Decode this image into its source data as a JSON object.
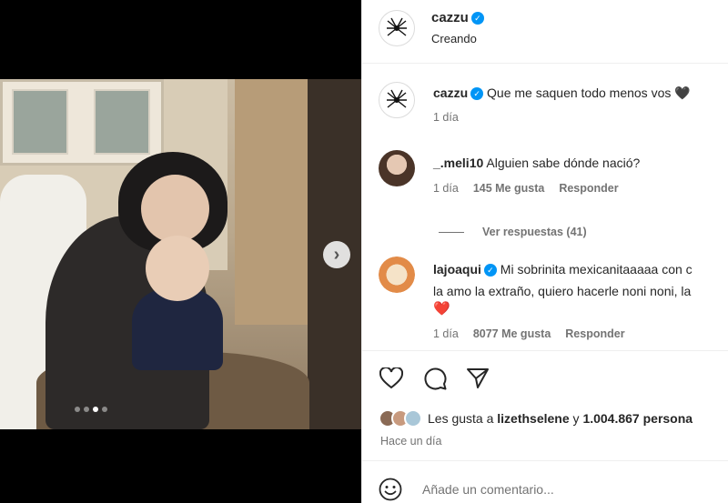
{
  "post": {
    "username": "cazzu",
    "location": "Creando",
    "caption": "Que me saquen todo menos vos",
    "caption_emoji": "🖤",
    "caption_time": "1 día",
    "carousel": {
      "total": 4,
      "active": 2
    }
  },
  "comments": [
    {
      "username": "_.meli10",
      "text": "Alguien sabe dónde nació?",
      "time": "1 día",
      "likes": "145 Me gusta",
      "reply": "Responder",
      "view_replies": "Ver respuestas (41)"
    },
    {
      "username": "lajoaqui",
      "text_line1": "Mi sobrinita mexicanitaaaaa con c",
      "text_line2": "la amo la extraño, quiero hacerle noni noni, la",
      "text_emoji": "❤️",
      "time": "1 día",
      "likes": "8077 Me gusta",
      "reply": "Responder"
    }
  ],
  "likes_summary": {
    "prefix": "Les gusta a",
    "user": "lizethselene",
    "connector": "y",
    "count": "1.004.867 persona"
  },
  "time_ago": "Hace un día",
  "composer": {
    "placeholder": "Añade un comentario..."
  },
  "icons": [
    "spider-avatar-icon",
    "verified-icon",
    "heart-icon",
    "comment-icon",
    "share-icon",
    "emoji-icon",
    "chevron-right-icon"
  ],
  "colors": {
    "verified": "#0095f6",
    "muted": "#737373",
    "heart": "#ed4956"
  }
}
